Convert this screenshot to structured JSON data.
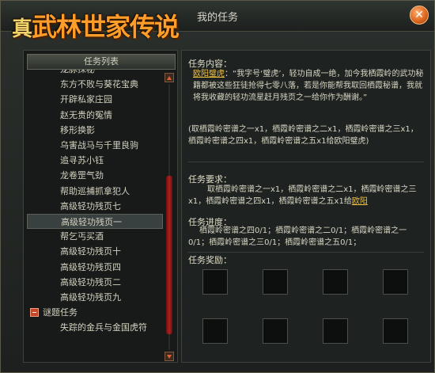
{
  "window": {
    "title": "我的任务"
  },
  "logo": {
    "text": "武林世家传说",
    "prefix": "真"
  },
  "task_list": {
    "header": "任务列表",
    "items": [
      {
        "label": "龙脉探秘",
        "selected": false
      },
      {
        "label": "东方不败与葵花宝典",
        "selected": false
      },
      {
        "label": "开辟私家庄园",
        "selected": false
      },
      {
        "label": "赵无贵的冤情",
        "selected": false
      },
      {
        "label": "移形换影",
        "selected": false
      },
      {
        "label": "乌害战马与千里良驹",
        "selected": false
      },
      {
        "label": "追寻苏小钰",
        "selected": false
      },
      {
        "label": "龙卷罡气劲",
        "selected": false
      },
      {
        "label": "帮助巡捕抓拿犯人",
        "selected": false
      },
      {
        "label": "高级轻功残页七",
        "selected": false
      },
      {
        "label": "高级轻功残页一",
        "selected": true
      },
      {
        "label": "帮乞丐买酒",
        "selected": false
      },
      {
        "label": "高级轻功残页十",
        "selected": false
      },
      {
        "label": "高级轻功残页四",
        "selected": false
      },
      {
        "label": "高级轻功残页二",
        "selected": false
      },
      {
        "label": "高级轻功残页九",
        "selected": false
      }
    ],
    "category": "谜题任务",
    "category_items": [
      {
        "label": "失踪的金兵与金国虎符"
      }
    ]
  },
  "details": {
    "content_label": "任务内容：",
    "npc_name": "欧阳璧虎",
    "content_text": "：“我字号‘璧虎’，轻功自成一绝，加今我栖霞岭的武功秘籍都被这些狂徒抢得七零八落，若是你能帮我取回栖霞秘谱，我就将我收藏的轻功流星赶月残页之一给你作为酬谢。”",
    "content_note": "(取栖霞岭密谱之一x1，栖霞岭密谱之二x1，栖霞岭密谱之三x1，栖霞岭密谱之四x1，栖霞岭密谱之五x1给欧阳璧虎)",
    "requirement_label": "任务要求：",
    "requirement_text": "取栖霞岭密谱之一x1，栖霞岭密谱之二x1，栖霞岭密谱之三x1，栖霞岭密谱之四x1，栖霞岭密谱之五x1给",
    "requirement_npc": "欧阳",
    "progress_label": "任务进度：",
    "progress_text": "栖霞岭密谱之四0/1；栖霞岭密谱之二0/1；栖霞岭密谱之一0/1；栖霞岭密谱之三0/1；栖霞岭密谱之五0/1；",
    "reward_label": "任务奖励："
  }
}
